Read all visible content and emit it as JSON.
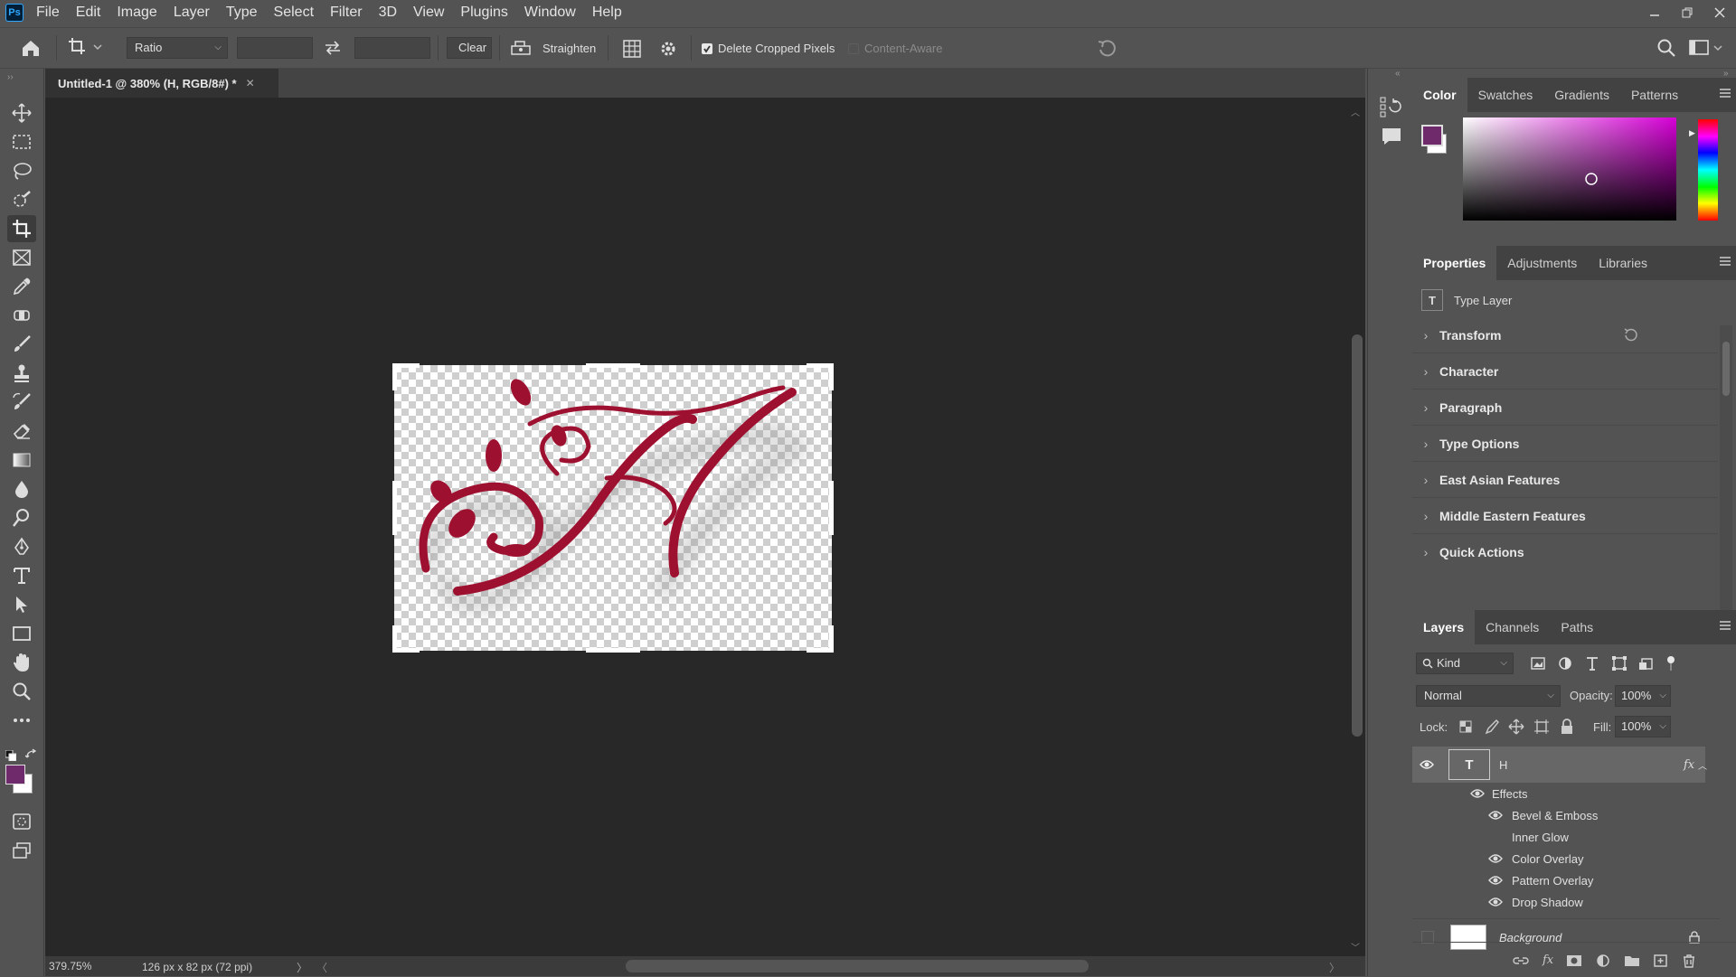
{
  "app": {
    "logo": "Ps"
  },
  "menu": [
    "File",
    "Edit",
    "Image",
    "Layer",
    "Type",
    "Select",
    "Filter",
    "3D",
    "View",
    "Plugins",
    "Window",
    "Help"
  ],
  "options": {
    "ratio_value": "Ratio",
    "clear_label": "Clear",
    "straighten_label": "Straighten",
    "delete_cropped_label": "Delete Cropped Pixels",
    "content_aware_label": "Content-Aware"
  },
  "document": {
    "tab_title": "Untitled-1 @ 380% (H, RGB/8#) *"
  },
  "status": {
    "zoom": "379.75%",
    "doc_info": "126 px x 82 px (72 ppi)"
  },
  "colors": {
    "foreground": "#6e2a6b",
    "background": "#ffffff",
    "accent": "#1473e6",
    "letter": "#9e1030"
  },
  "color_panel": {
    "tabs": [
      "Color",
      "Swatches",
      "Gradients",
      "Patterns"
    ]
  },
  "properties_panel": {
    "tabs": [
      "Properties",
      "Adjustments",
      "Libraries"
    ],
    "layer_type": "Type Layer",
    "sections": [
      "Transform",
      "Character",
      "Paragraph",
      "Type Options",
      "East Asian Features",
      "Middle Eastern Features",
      "Quick Actions"
    ]
  },
  "layers_panel": {
    "tabs": [
      "Layers",
      "Channels",
      "Paths"
    ],
    "filter_kind": "Kind",
    "blend_mode": "Normal",
    "opacity_label": "Opacity:",
    "opacity_value": "100%",
    "lock_label": "Lock:",
    "fill_label": "Fill:",
    "fill_value": "100%",
    "type_layer_name": "H",
    "fx_label": "fx",
    "effects_label": "Effects",
    "effects": [
      "Bevel & Emboss",
      "Inner Glow",
      "Color Overlay",
      "Pattern Overlay",
      "Drop Shadow"
    ],
    "background_layer_name": "Background"
  }
}
